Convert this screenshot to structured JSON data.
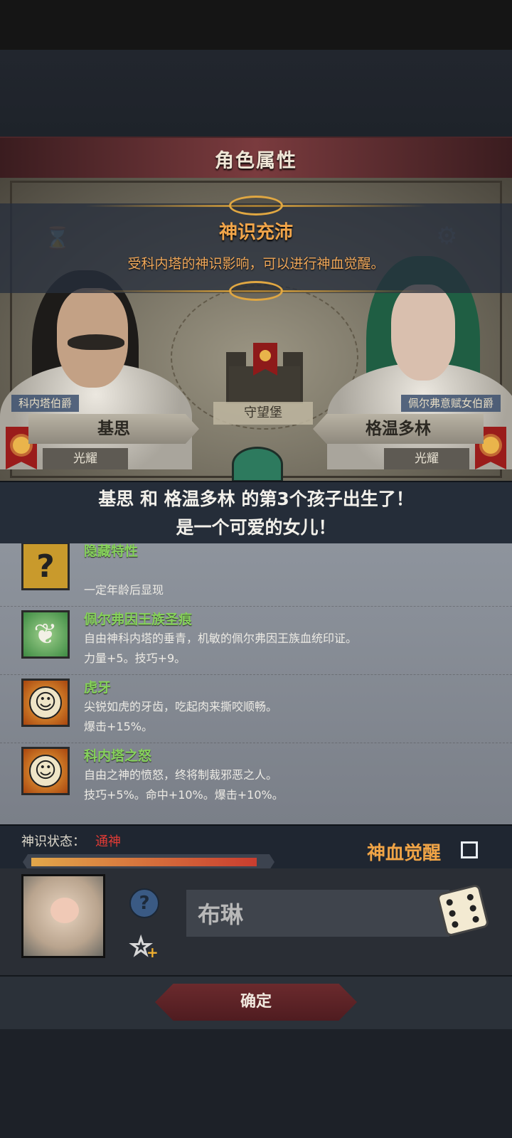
{
  "screen": {
    "title": "角色属性",
    "info": {
      "title": "神识充沛",
      "description": "受科内塔的神识影响，可以进行神血觉醒。"
    },
    "map": {
      "location_label": "守望堡"
    },
    "father": {
      "title": "科内塔伯爵",
      "name": "基思",
      "trait": "光耀"
    },
    "mother": {
      "title": "佩尔弗意赋女伯爵",
      "name": "格温多林",
      "trait": "光耀"
    },
    "birth_message": {
      "line1": "基思 和 格温多林 的第3个孩子出生了！",
      "line2": "是一个可爱的女儿！"
    },
    "traits": [
      {
        "icon": "question-icon",
        "name": "隐藏特性",
        "line1": "",
        "line2": "一定年龄后显现"
      },
      {
        "icon": "leaf-icon",
        "name": "佩尔弗因王族圣痕",
        "line1": "自由神科内塔的垂青，机敏的佩尔弗因王族血统印证。",
        "line2": "力量+5。技巧+9。"
      },
      {
        "icon": "smile-icon",
        "name": "虎牙",
        "line1": "尖锐如虎的牙齿，吃起肉来撕咬顺畅。",
        "line2": "爆击+15%。"
      },
      {
        "icon": "smile-icon",
        "name": "科内塔之怒",
        "line1": "自由之神的愤怒，终将制裁邪恶之人。",
        "line2": "技巧+5%。命中+10%。爆击+10%。"
      }
    ],
    "status": {
      "label": "神识状态：",
      "value": "通神",
      "progress": 0.96,
      "awaken_label": "神血觉醒",
      "awaken_checked": false
    },
    "child": {
      "name_value": "布琳",
      "help_symbol": "?",
      "star_plus": "+"
    },
    "confirm_label": "确定",
    "colors": {
      "accent_orange": "#f0a446",
      "trait_green": "#86d25b",
      "status_red": "#e23b35",
      "banner_red": "#7a3b3e"
    }
  }
}
